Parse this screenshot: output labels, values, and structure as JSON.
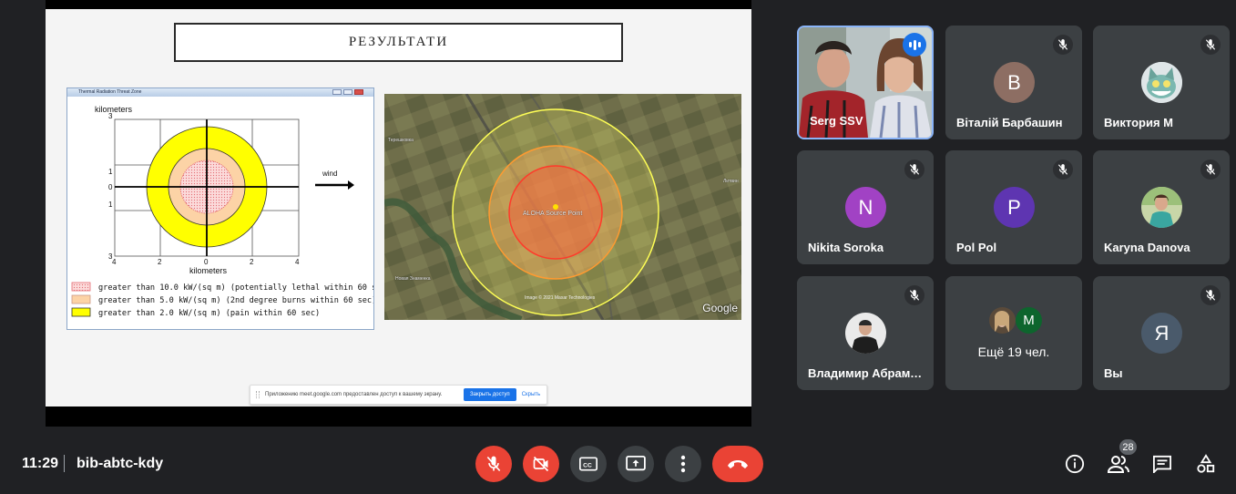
{
  "presentation": {
    "slide_title": "РЕЗУЛЬТАТИ",
    "aloha": {
      "window_title": "Thermal Radiation Threat Zone",
      "y_axis_label": "kilometers",
      "x_axis_label": "kilometers",
      "y_ticks": [
        "3",
        "1",
        "0",
        "1",
        "3"
      ],
      "x_ticks": [
        "4",
        "2",
        "0",
        "2",
        "4"
      ],
      "wind_label": "wind",
      "legend": [
        {
          "text": "greater than 10.0 kW/(sq m) (potentially lethal within 60 sec)",
          "color": "#f4a0a6"
        },
        {
          "text": "greater than 5.0 kW/(sq m) (2nd degree burns within 60 sec)",
          "color": "#fcd3a6"
        },
        {
          "text": "greater than 2.0 kW/(sq m) (pain within 60 sec)",
          "color": "#ffff00"
        }
      ]
    },
    "map": {
      "source_label": "ALOHA Source Point",
      "town_labels": [
        "Терешковка",
        "Литвин",
        "Новая Знаменка"
      ],
      "attribution": "Image © 2021 Maxar Technologies",
      "logo": "Google"
    },
    "share_bar": {
      "text": "Приложению meet.google.com предоставлен доступ к вашему экрану.",
      "stop_label": "Закрыть доступ",
      "hide_label": "Скрыть"
    }
  },
  "participants": [
    {
      "name": "Serg SSV",
      "type": "video",
      "speaking": true
    },
    {
      "name": "Віталій Барбашин",
      "initial": "В",
      "avatar_color": "#8d6e63",
      "muted": true
    },
    {
      "name": "Виктория М",
      "type": "image-avatar",
      "muted": true
    },
    {
      "name": "Nikita Soroka",
      "initial": "N",
      "avatar_color": "#a142c4",
      "muted": true
    },
    {
      "name": "Pol Pol",
      "initial": "P",
      "avatar_color": "#5e35b1",
      "muted": true
    },
    {
      "name": "Karyna Danova",
      "type": "image-avatar",
      "muted": true
    },
    {
      "name": "Владимир Абрамов",
      "type": "image-avatar",
      "muted": true
    },
    {
      "more_label": "Ещё 19 чел.",
      "more_initial": "M"
    },
    {
      "name": "Вы",
      "initial": "Я",
      "avatar_color": "#4a5a6b",
      "muted": true
    }
  ],
  "bottom_bar": {
    "time": "11:29",
    "meeting_code": "bib-abtc-kdy",
    "people_count": "28"
  }
}
